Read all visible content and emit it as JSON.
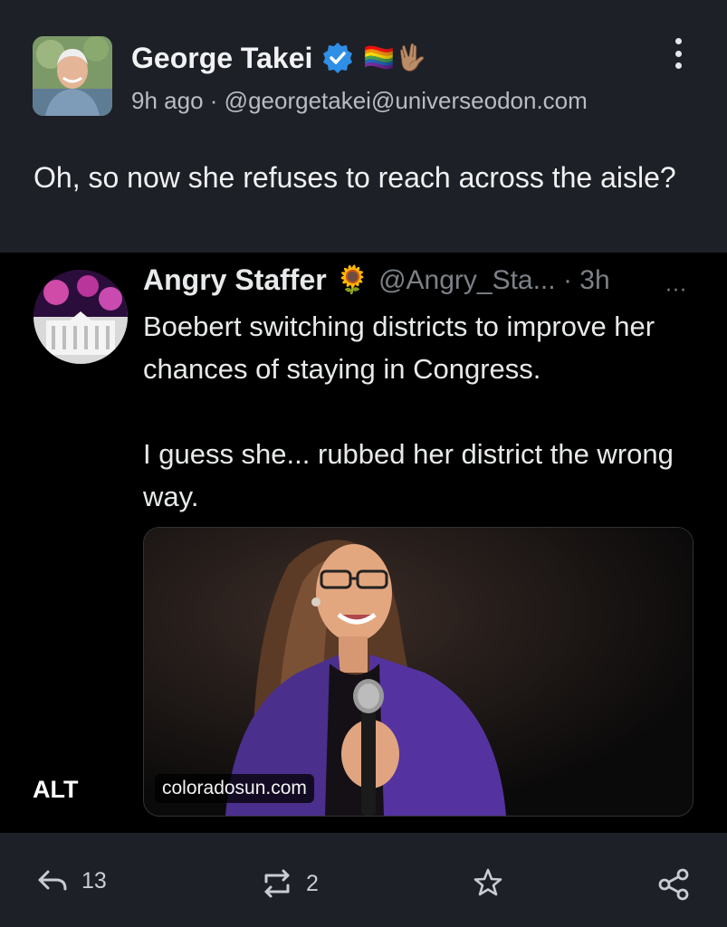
{
  "post": {
    "author_name": "George Takei",
    "author_emojis": "🏳️‍🌈🖖🏽",
    "timestamp": "9h ago",
    "separator": "·",
    "handle": "@georgetakei@universeodon.com",
    "text": "Oh, so now she refuses to reach across the aisle?"
  },
  "embedded": {
    "quoted_name": "Angry Staffer",
    "quoted_emoji": "🌻",
    "quoted_handle_time": "@Angry_Sta... · 3h",
    "quoted_more": "···",
    "quoted_text": "Boebert switching districts to improve her chances of staying in Congress.\n\nI guess she... rubbed her district the wrong way.",
    "link_domain": "coloradosun.com",
    "alt_label": "ALT"
  },
  "actions": {
    "reply_count": "13",
    "boost_count": "2"
  },
  "colors": {
    "background": "#1d2026",
    "verified": "#2f8fe6"
  }
}
